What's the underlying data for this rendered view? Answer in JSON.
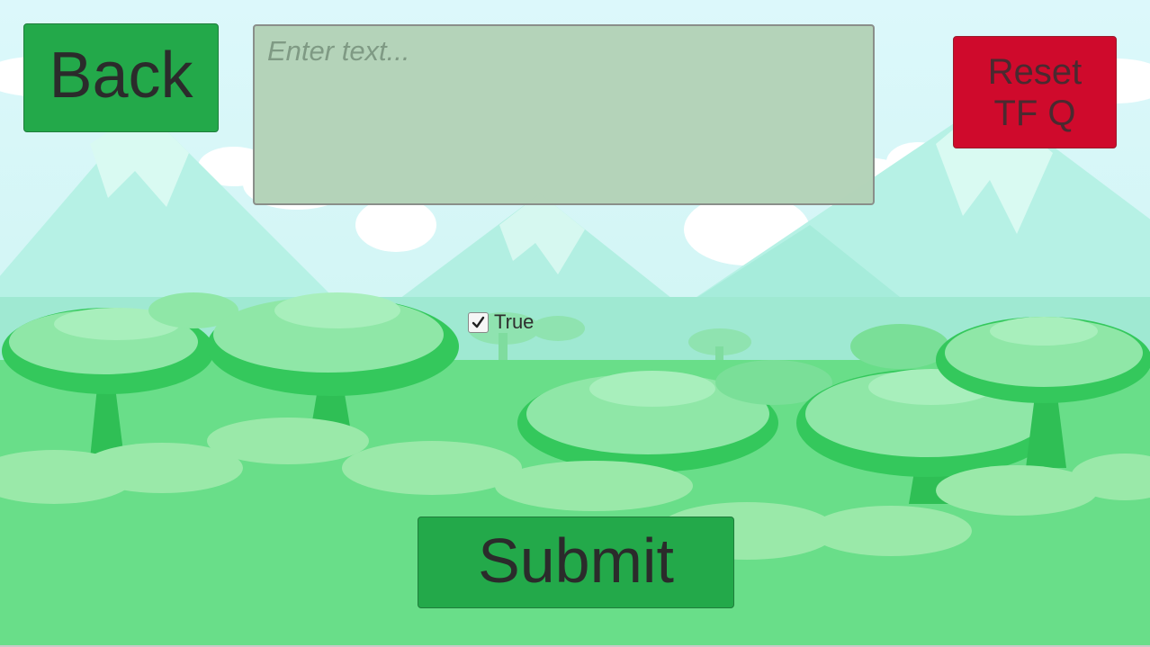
{
  "buttons": {
    "back_label": "Back",
    "reset_label": "Reset\nTF Q",
    "submit_label": "Submit"
  },
  "text_field": {
    "placeholder": "Enter text...",
    "value": ""
  },
  "toggle": {
    "label": "True",
    "checked": true
  },
  "colors": {
    "sky": "#dff7fb",
    "green_button": "#23a94a",
    "red_button": "#cf0a2c",
    "ground": "#69de89"
  }
}
